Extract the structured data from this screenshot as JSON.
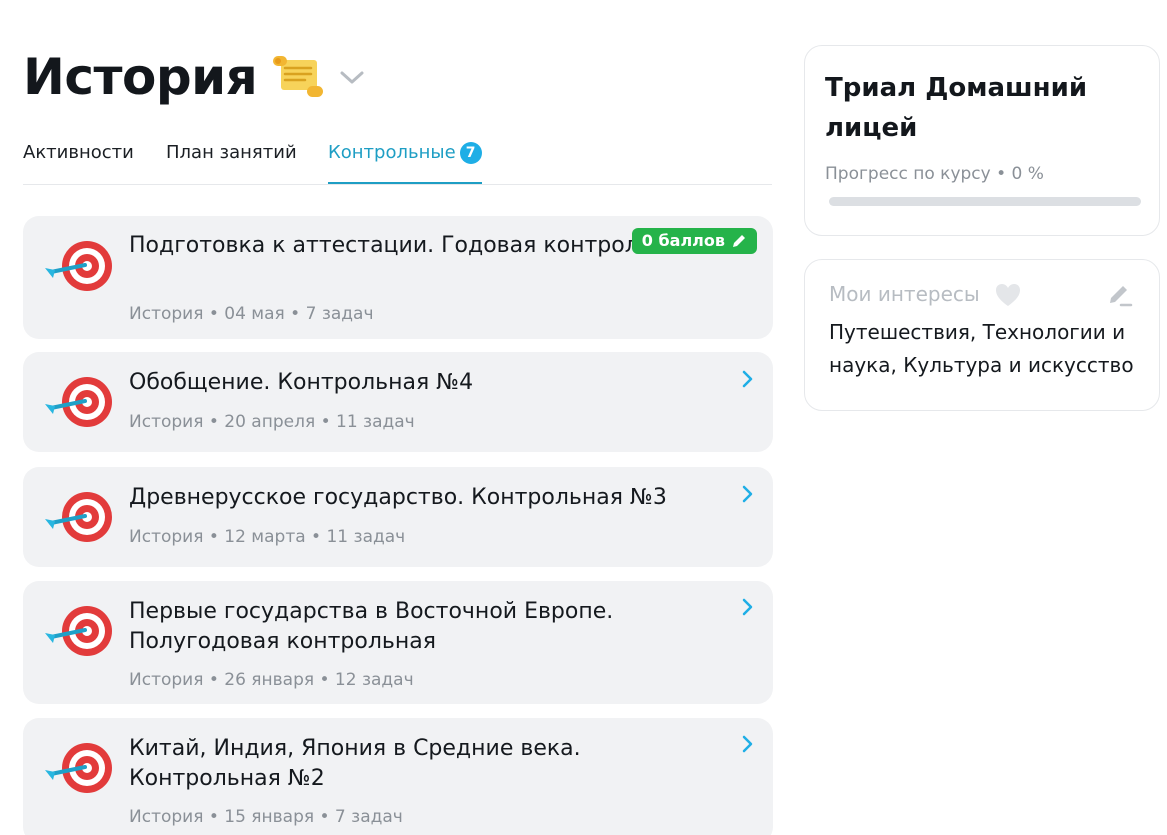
{
  "header": {
    "title": "История",
    "title_icon": "scroll-icon",
    "dropdown_icon": "chevron-down-icon"
  },
  "tabs": [
    {
      "label": "Активности",
      "active": false
    },
    {
      "label": "План занятий",
      "active": false
    },
    {
      "label": "Контрольные",
      "active": true,
      "badge": "7"
    }
  ],
  "colors": {
    "accent": "#1e9ec4",
    "badge": "#1eaee6",
    "score_green": "#25b34a",
    "card_bg": "#f1f2f4"
  },
  "tests": [
    {
      "title": "Подготовка к аттестации. Годовая контрольная",
      "meta": "История • 04 мая • 7 задач",
      "score": "0 баллов",
      "icon": "dart-target-icon"
    },
    {
      "title": "Обобщение. Контрольная №4",
      "meta": "История • 20 апреля • 11 задач",
      "icon": "dart-target-icon"
    },
    {
      "title": "Древнерусское государство. Контрольная №3",
      "meta": "История • 12 марта • 11 задач",
      "icon": "dart-target-icon"
    },
    {
      "title": "Первые государства в Восточной Европе. Полугодовая контрольная",
      "meta": "История • 26 января • 12 задач",
      "icon": "dart-target-icon"
    },
    {
      "title": "Китай, Индия, Япония в Средние века. Контрольная №2",
      "meta": "История • 15 января • 7 задач",
      "icon": "dart-target-icon"
    }
  ],
  "course": {
    "title": "Триал Домашний лицей",
    "progress_label": "Прогресс по курсу • 0 %",
    "progress": 0
  },
  "interests": {
    "title": "Мои интересы",
    "text": "Путешествия, Технологии и наука, Культура и искусство"
  }
}
